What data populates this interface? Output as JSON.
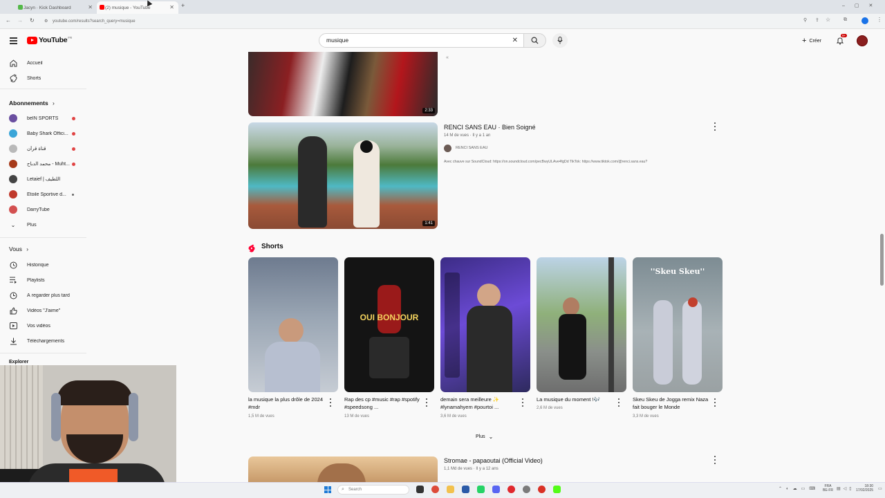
{
  "browser": {
    "tabs": [
      {
        "label": "Jacyn · Kick Dashboard",
        "active": false
      },
      {
        "label": "(2) musique - YouTube",
        "active": true
      }
    ],
    "new_tab": "+",
    "url": "youtube.com/results?search_query=musique"
  },
  "header": {
    "logo_text": "YouTube",
    "logo_region": "FR",
    "search_value": "musique",
    "create_label": "Créer",
    "notif_count": "9+"
  },
  "sidebar": {
    "main": [
      {
        "label": "Accueil",
        "icon": "home-icon"
      },
      {
        "label": "Shorts",
        "icon": "shorts-icon"
      }
    ],
    "subs_heading": "Abonnements",
    "subscriptions": [
      {
        "label": "beIN SPORTS",
        "live": true,
        "color": "#6a4fa0"
      },
      {
        "label": "Baby Shark Offici...",
        "live": true,
        "color": "#3aa5d8"
      },
      {
        "label": "قناة قرآن",
        "live": true,
        "color": "#b9b9b9"
      },
      {
        "label": "محمد الدباح - Muht...",
        "live": true,
        "color": "#a63a1a"
      },
      {
        "label": "Letaief | اللطيف",
        "live": false,
        "color": "#444"
      },
      {
        "label": "Etoile Sportive d...",
        "live": false,
        "color": "#c0392b"
      },
      {
        "label": "DarryTube",
        "live": false,
        "color": "#d35050"
      },
      {
        "label": "Plus",
        "live": false,
        "color": ""
      }
    ],
    "you_heading": "Vous",
    "you_items": [
      {
        "label": "Historique",
        "icon": "history-icon"
      },
      {
        "label": "Playlists",
        "icon": "playlist-icon"
      },
      {
        "label": "À regarder plus tard",
        "icon": "clock-icon"
      },
      {
        "label": "Vidéos \"J'aime\"",
        "icon": "thumb-up-icon"
      },
      {
        "label": "Vos vidéos",
        "icon": "video-icon"
      },
      {
        "label": "Téléchargements",
        "icon": "download-icon"
      }
    ],
    "explore_heading": "Explorer"
  },
  "results": {
    "first_duration": "2:33",
    "video2": {
      "title": "RENCI SANS EAU · Bien Soigné",
      "meta": "14 M de vues · Il y a 1 an",
      "channel": "RENCI SANS EAU",
      "desc": "Avec chauve sur SoundCloud: https://on.soundcloud.com/pecBwyULAve4fgDd TikTok: https://www.tiktok.com/@renci.sans.eau?",
      "duration": "1:41"
    },
    "shorts_heading": "Shorts",
    "shorts": [
      {
        "title": "la musique la plus drôle de 2024 #mdr",
        "views": "1,5 M de vues"
      },
      {
        "title": "Rap des cp #music #rap #spotify #speedsong ...",
        "views": "13 M de vues"
      },
      {
        "title": "demain sera meilleure ✨ #lynamahyem #pourtoi ...",
        "views": "3,6 M de vues"
      },
      {
        "title": "La musique du moment !🎶",
        "views": "2,6 M de vues"
      },
      {
        "title": "Skeu Skeu de Jogga remix Naza fait bouger le Monde",
        "views": "3,3 M de vues"
      }
    ],
    "short2_overlay": "OUI BONJOUR",
    "short5_overlay": "''Skeu Skeu''",
    "more_label": "Plus",
    "video3": {
      "title": "Stromae - papaoutai (Official Video)",
      "meta": "1,1 Md de vues · Il y a 12 ans"
    }
  },
  "taskbar": {
    "search_label": "Search",
    "lang": "FRA",
    "lang_sub": "BE-FR",
    "time": "18:30",
    "date": "17/02/2025"
  },
  "colors": {
    "yt_red": "#ff0000",
    "bg": "#f9f9f9",
    "live_dot": "#e04343"
  }
}
